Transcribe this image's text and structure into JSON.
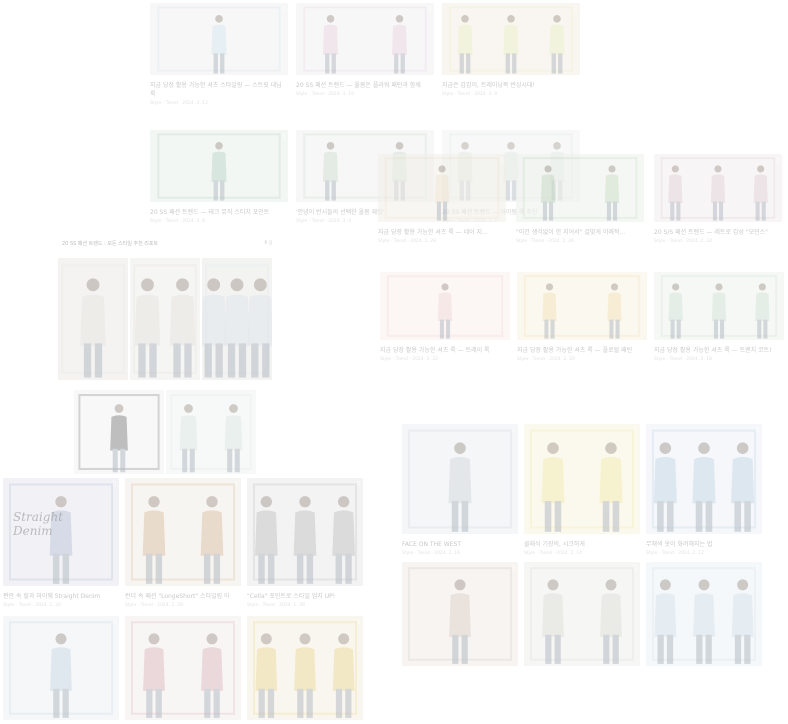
{
  "top_grid": [
    {
      "title": "지금 당장 활용 가능한 셔츠 스타일링 — 스트릿 데님 룩",
      "meta": "Style · Trend · 2024. 3. 12",
      "bg": "#f0f1ef",
      "accent": "#bcd6e6"
    },
    {
      "title": "20 SS 패션 트렌드 — 올봄은 플라워 패턴과 함께",
      "meta": "Style · Trend · 2024. 3. 10",
      "bg": "#f4f2f4",
      "accent": "#d8b8cc"
    },
    {
      "title": "지금은 갑갑이, 트레이닝복 반싱시대!",
      "meta": "Style · Trend · 2024. 3. 8",
      "bg": "#f5efe6",
      "accent": "#d9e8a0"
    },
    {
      "title": "20 SS 패션 트렌드 — 테크 뮤직 스티치 포인트",
      "meta": "Style · Trend · 2024. 3. 6",
      "bg": "#e9f1ec",
      "accent": "#8fb8a4"
    },
    {
      "title": "'안녕이 반시들의 선택한 올봄 재킷'",
      "meta": "Style · Trend · 2024. 3. 4",
      "bg": "#eff1ef",
      "accent": "#b2c9b7"
    },
    {
      "title": "20 SS 패션 트렌드 — 아이템 룩 추천",
      "meta": "Style · Trend · 2024. 3. 2",
      "bg": "#eef0ee",
      "accent": "#c7d8c9"
    }
  ],
  "right_grid": [
    {
      "title": "지금 당장 활용 가능한 셔츠 룩 — 네이 지...",
      "meta": "Style · Trend · 2024. 2. 28",
      "bg": "#f1efe9",
      "accent": "#e5d4b4"
    },
    {
      "title": "\"이건 생각없이 한 지어서\" 걸맞게 이례적...",
      "meta": "Style · Trend · 2024. 2. 26",
      "bg": "#eef2ed",
      "accent": "#a8c5a0"
    },
    {
      "title": "20 S/S 패션 트렌드 — 레트로 감성 \"모던스\"",
      "meta": "Style · Trend · 2024. 2. 24",
      "bg": "#f3eeef",
      "accent": "#cfb5c3"
    },
    {
      "title": "지금 당장 활용 가능한 셔츠 룩 — 트레이 룩",
      "meta": "Style · Trend · 2024. 2. 22",
      "bg": "#fbefed",
      "accent": "#e6c2bd"
    },
    {
      "title": "지금 당장 활용 가능한 셔츠 룩 — 플로럴 패턴",
      "meta": "Style · Trend · 2024. 2. 20",
      "bg": "#f9f3e3",
      "accent": "#ead08a"
    },
    {
      "title": "지금 당장 활용 가능한 셔츠 룩 — 트렌치 코트!",
      "meta": "Style · Trend · 2024. 2. 18",
      "bg": "#eef3ee",
      "accent": "#b6d1bd"
    }
  ],
  "mid_right_grid": [
    {
      "title": "FACE ON THE WEST",
      "meta": "Style · Trend · 2024. 2. 16",
      "bg": "#eceff2",
      "accent": "#b7c0c6"
    },
    {
      "title": "클래식 기장의, 시크하게",
      "meta": "Style · Trend · 2024. 2. 14",
      "bg": "#f9f5df",
      "accent": "#e9dc7a"
    },
    {
      "title": "무채색 옷이 화려해지는 법",
      "meta": "Style · Trend · 2024. 2. 12",
      "bg": "#edf2f6",
      "accent": "#9fbcd6"
    },
    {
      "title": "",
      "meta": "",
      "bg": "#f1ece8",
      "accent": "#c4b1a4"
    },
    {
      "title": "",
      "meta": "",
      "bg": "#f0f0ee",
      "accent": "#c9c6be"
    },
    {
      "title": "",
      "meta": "",
      "bg": "#eef3f6",
      "accent": "#b8cfe0"
    }
  ],
  "left_pane": {
    "header": "20 SS 패션 트렌드 : 모든 스타일 추천 리포트",
    "icons": [
      "share-icon",
      "bookmark-icon"
    ]
  },
  "bottom_grid": [
    {
      "title": "편안 속 힐과 마이웨 Straight Denim",
      "meta": "Style · Trend · 2024. 1. 30",
      "bg": "#e8e9ef",
      "accent": "#8d9cc0",
      "handwriting": "Straight Denim"
    },
    {
      "title": "런더 속 패션 \"LongeShort\" 스타일링 아",
      "meta": "Style · Trend · 2024. 1. 28",
      "bg": "#f2ede6",
      "accent": "#c49a6c"
    },
    {
      "title": "\"Cella\" 포인트로 스타일 업지 UP!",
      "meta": "Style · Trend · 2024. 1. 26",
      "bg": "#ebebeb",
      "accent": "#9a9a9a"
    },
    {
      "title": "",
      "meta": "",
      "bg": "#eef2f5",
      "accent": "#a9c2d6"
    },
    {
      "title": "",
      "meta": "",
      "bg": "#f3eeee",
      "accent": "#c98f98"
    },
    {
      "title": "",
      "meta": "",
      "bg": "#f5f0e2",
      "accent": "#e3c45a"
    }
  ]
}
